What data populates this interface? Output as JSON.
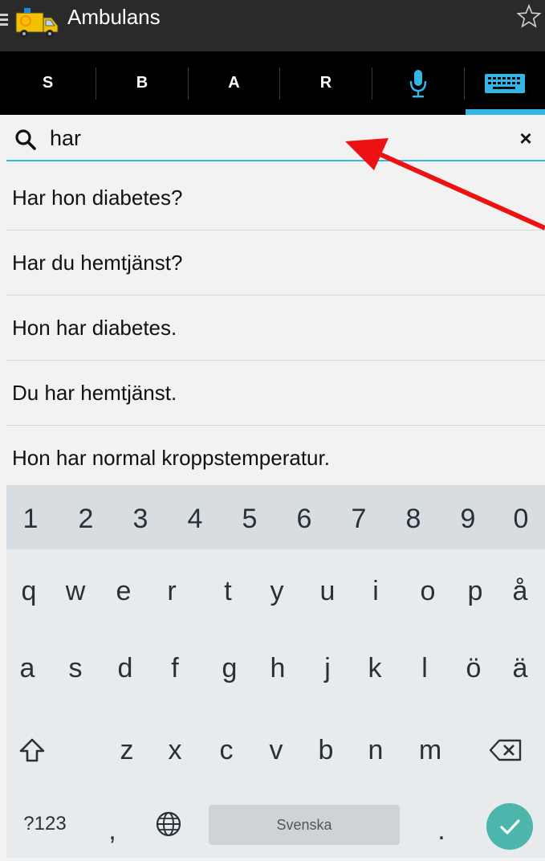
{
  "app": {
    "title": "Ambulans"
  },
  "tabs": [
    {
      "label": "S"
    },
    {
      "label": "B"
    },
    {
      "label": "A"
    },
    {
      "label": "R"
    },
    {
      "label": "",
      "icon": "microphone-icon"
    },
    {
      "label": "",
      "icon": "keyboard-icon",
      "selected": true
    }
  ],
  "colors": {
    "accent": "#33b5e5",
    "arrow": "#ee1111",
    "enter": "#4db6ac"
  },
  "search": {
    "value": "har",
    "clear_label": "×"
  },
  "results": [
    {
      "text": "Har hon diabetes?"
    },
    {
      "text": "Har du hemtjänst?"
    },
    {
      "text": "Hon har diabetes."
    },
    {
      "text": "Du har hemtjänst."
    },
    {
      "text": "Hon har normal kroppstemperatur."
    }
  ],
  "keyboard": {
    "row_numbers": [
      "1",
      "2",
      "3",
      "4",
      "5",
      "6",
      "7",
      "8",
      "9",
      "0"
    ],
    "row1": [
      "q",
      "w",
      "e",
      "r",
      "t",
      "y",
      "u",
      "i",
      "o",
      "p",
      "å"
    ],
    "row2": [
      "a",
      "s",
      "d",
      "f",
      "g",
      "h",
      "j",
      "k",
      "l",
      "ö",
      "ä"
    ],
    "row3": [
      "z",
      "x",
      "c",
      "v",
      "b",
      "n",
      "m"
    ],
    "symbols_label": "?123",
    "comma": ",",
    "period": ".",
    "space_label": "Svenska"
  }
}
